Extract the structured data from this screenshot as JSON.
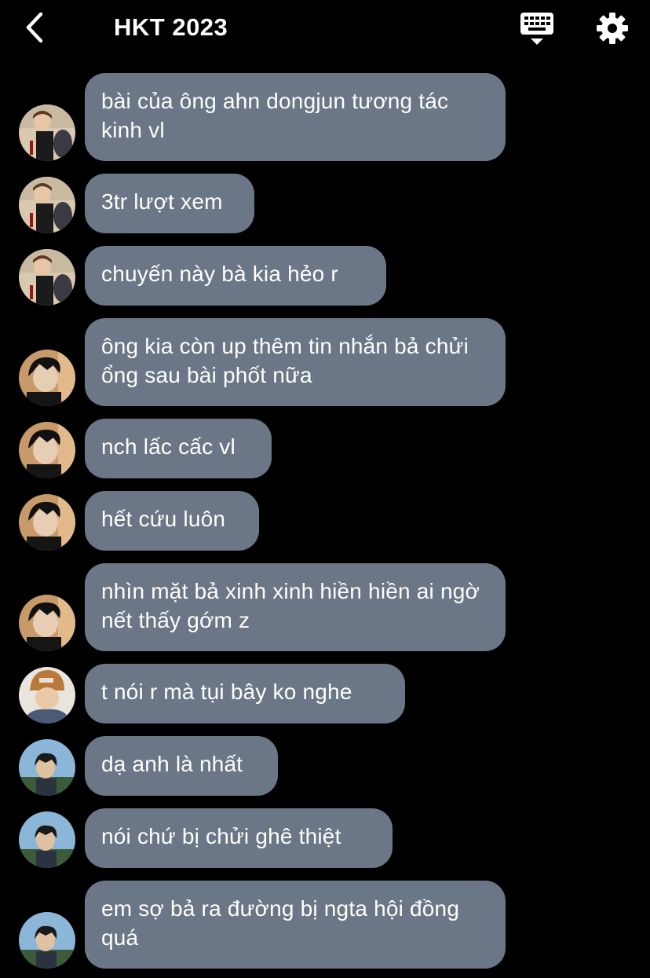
{
  "header": {
    "title": "HKT 2023",
    "back_icon": "chevron-left-icon",
    "keyboard_icon": "keyboard-icon",
    "settings_icon": "gear-icon"
  },
  "colors": {
    "background": "#000000",
    "bubble": "#6b7786",
    "text": "#ffffff"
  },
  "messages": [
    {
      "sender": "user-a",
      "text": "bài của ông ahn dongjun tương tác kinh vl"
    },
    {
      "sender": "user-a",
      "text": "3tr lượt xem"
    },
    {
      "sender": "user-a",
      "text": "chuyến này bà kia hẻo r"
    },
    {
      "sender": "user-b",
      "text": "ông kia còn up thêm tin nhắn bả chửi ổng sau bài phốt nữa"
    },
    {
      "sender": "user-b",
      "text": "nch lấc cấc vl"
    },
    {
      "sender": "user-b",
      "text": "hết cứu luôn"
    },
    {
      "sender": "user-b",
      "text": "nhìn mặt bả xinh xinh hiền hiền ai ngờ nết thấy gớm z"
    },
    {
      "sender": "user-c",
      "text": "t nói r mà tụi bây ko nghe"
    },
    {
      "sender": "user-d",
      "text": "dạ anh là nhất"
    },
    {
      "sender": "user-d",
      "text": "nói chứ bị chửi ghê thiệt"
    },
    {
      "sender": "user-d",
      "text": "em sợ bả ra đường bị ngta hội đồng quá"
    }
  ]
}
